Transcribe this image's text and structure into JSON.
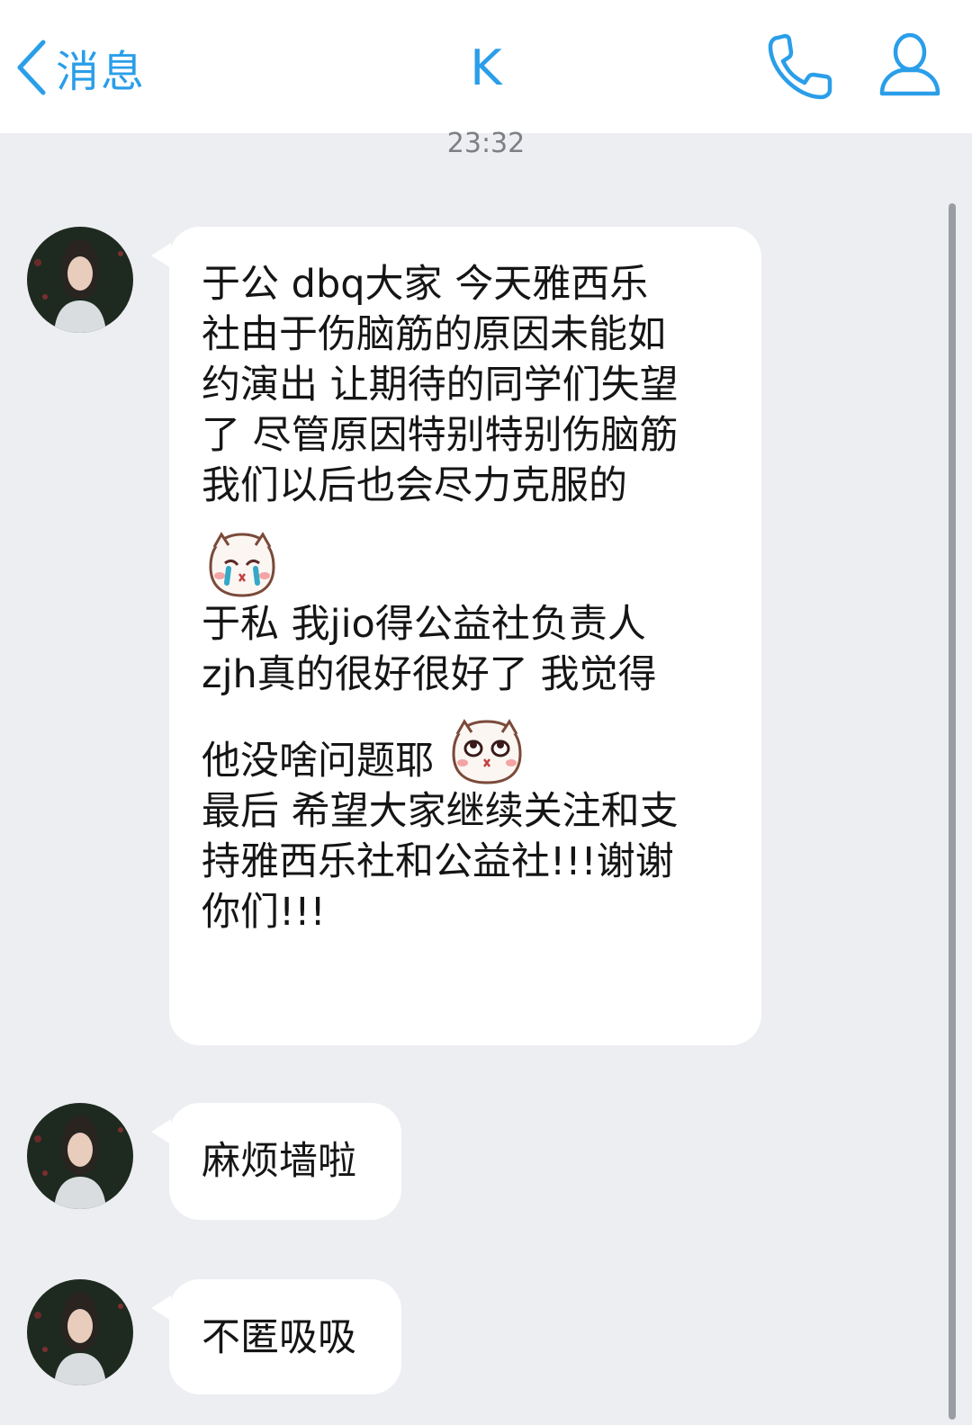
{
  "header": {
    "back_label": "消息",
    "title": "K"
  },
  "timestamp": "23:32",
  "messages": [
    {
      "lines": [
        "于公 dbq大家 今天雅西乐",
        "社由于伤脑筋的原因未能如",
        "约演出 让期待的同学们失望",
        "了 尽管原因特别特别伤脑筋",
        "我们以后也会尽力克服的"
      ],
      "emoji_1": "crying-face-emoji",
      "lines_b": [
        "于私 我jio得公益社负责人",
        "zjh真的很好很好了 我觉得"
      ],
      "line_c": "他没啥问题耶",
      "emoji_2": "hopeful-face-emoji",
      "lines_d": [
        "最后 希望大家继续关注和支",
        "持雅西乐社和公益社!!!谢谢",
        "你们!!!"
      ]
    },
    {
      "text": "麻烦墙啦"
    },
    {
      "text": "不匿吸吸"
    }
  ],
  "colors": {
    "accent": "#2a9ee9",
    "background": "#edeef2",
    "bubble": "#ffffff"
  }
}
